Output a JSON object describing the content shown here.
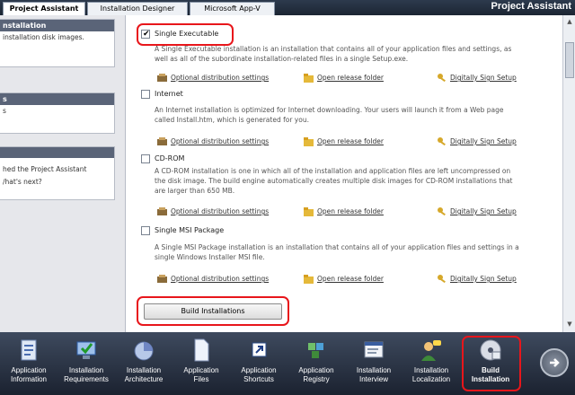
{
  "tabs": [
    "Project Assistant",
    "Installation Designer",
    "Microsoft App-V"
  ],
  "app_title": "Project Assistant",
  "left_panel": {
    "box1_title": "nstallation",
    "box1_text": " installation disk images.",
    "box2_title": "s",
    "box2_text": "s",
    "box3_text_line1": "hed the Project Assistant",
    "box3_text_line2": "/hat's next?"
  },
  "options": [
    {
      "label": "Single Executable",
      "checked": true,
      "desc": [
        "A Single Executable installation is an installation that contains all of your application files and settings, as",
        "well as all of the subordinate installation-related files in a single Setup.exe."
      ]
    },
    {
      "label": "Internet",
      "checked": false,
      "desc": [
        "An Internet installation is optimized for Internet downloading. Your users will launch it from a Web page",
        "called Install.htm, which is generated for you."
      ]
    },
    {
      "label": "CD-ROM",
      "checked": false,
      "desc": [
        "A CD-ROM installation is one in which all of the installation and application files are left uncompressed on",
        "the disk image. The build engine automatically creates multiple disk images for CD-ROM installations that",
        "are larger than 650 MB."
      ]
    },
    {
      "label": "Single MSI Package",
      "checked": false,
      "desc": [
        "A Single MSI Package installation is an installation that contains all of your application files and settings in a",
        "single Windows Installer MSI file."
      ]
    }
  ],
  "links": {
    "distribution": "Optional distribution settings",
    "release": "Open release folder",
    "sign": "Digitally Sign Setup"
  },
  "build_button": "Build Installations",
  "nav": [
    {
      "l1": "Application",
      "l2": "Information"
    },
    {
      "l1": "Installation",
      "l2": "Requirements"
    },
    {
      "l1": "Installation",
      "l2": "Architecture"
    },
    {
      "l1": "Application",
      "l2": "Files"
    },
    {
      "l1": "Application",
      "l2": "Shortcuts"
    },
    {
      "l1": "Application",
      "l2": "Registry"
    },
    {
      "l1": "Installation",
      "l2": "Interview"
    },
    {
      "l1": "Installation",
      "l2": "Localization"
    },
    {
      "l1": "Build",
      "l2": "Installation"
    }
  ],
  "colors": {
    "highlight": "#e8161b",
    "nav_bg": "#1b2230"
  },
  "icons": [
    "settings-icon",
    "folder-icon",
    "key-icon",
    "right-arrow-icon"
  ]
}
